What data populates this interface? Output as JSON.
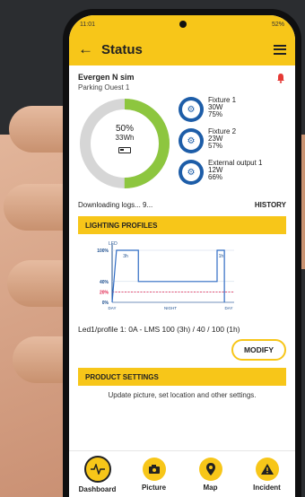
{
  "status_bar": {
    "time": "11:01",
    "battery": "52%"
  },
  "header": {
    "title": "Status"
  },
  "device": {
    "name": "Evergen N sim",
    "location": "Parking Ouest 1"
  },
  "battery": {
    "percent_label": "50%",
    "energy": "33Wh",
    "level": 0.5
  },
  "fixtures": [
    {
      "name": "Fixture 1",
      "power": "30W",
      "level": "75%"
    },
    {
      "name": "Fixture 2",
      "power": "23W",
      "level": "57%"
    },
    {
      "name": "External output 1",
      "power": "12W",
      "level": "66%"
    }
  ],
  "logs": {
    "status": "Downloading logs... 9...",
    "history_label": "HISTORY"
  },
  "lighting": {
    "section_title": "LIGHTING PROFILES",
    "profile_text": "Led1/profile 1: 0A - LMS 100 (3h) / 40 / 100 (1h)",
    "modify_label": "MODIFY"
  },
  "chart_data": {
    "type": "line",
    "y_tick_labels": [
      "100%",
      "40%",
      "20%",
      "0%"
    ],
    "top_label": "LED",
    "x_tick_labels": [
      "DAY",
      "NIGHT",
      "DAY"
    ],
    "segment_labels": [
      "3h",
      "1h"
    ],
    "profile_points": [
      [
        0,
        0
      ],
      [
        0.6,
        100
      ],
      [
        3.6,
        100
      ],
      [
        3.6,
        40
      ],
      [
        14.4,
        40
      ],
      [
        14.4,
        100
      ],
      [
        15.4,
        100
      ],
      [
        15.4,
        0
      ]
    ],
    "threshold": 20,
    "ylim": [
      0,
      100
    ]
  },
  "product": {
    "section_title": "PRODUCT SETTINGS",
    "description": "Update picture, set location and other settings."
  },
  "nav": [
    {
      "label": "Dashboard",
      "icon": "pulse-icon"
    },
    {
      "label": "Picture",
      "icon": "camera-icon"
    },
    {
      "label": "Map",
      "icon": "location-pin-icon"
    },
    {
      "label": "Incident",
      "icon": "warning-icon"
    }
  ],
  "colors": {
    "accent": "#f7c619",
    "gauge_fill": "#8dc63f",
    "gauge_track": "#d6d6d6",
    "fixture_blue": "#1d5da8",
    "chart_line": "#2f6cc4",
    "threshold": "#e0214b",
    "alarm": "#e53935"
  }
}
